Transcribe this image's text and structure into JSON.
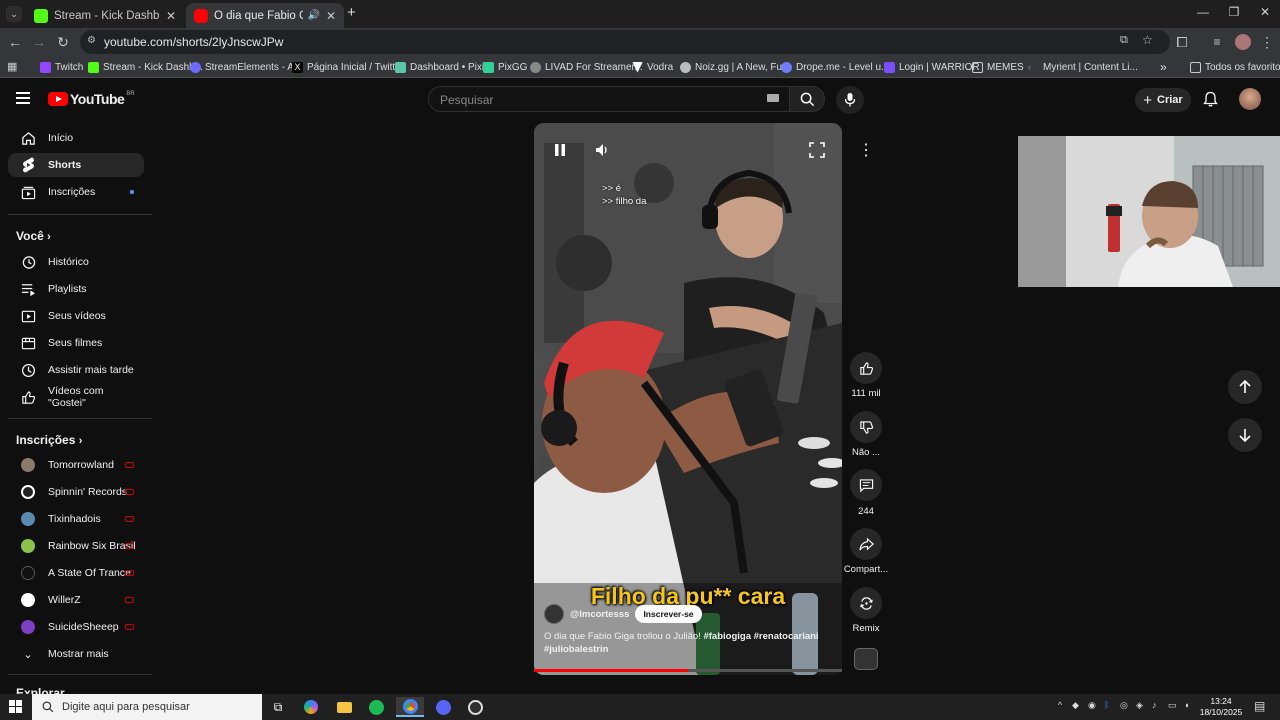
{
  "browser": {
    "tabs": [
      {
        "title": "Stream - Kick Dashboard",
        "favicon_color": "#53fc18"
      },
      {
        "title": "O dia que Fabio Giga trollou",
        "favicon_color": "#ff0000"
      }
    ],
    "new_tab_symbol": "+",
    "url": "youtube.com/shorts/2lyJnscwJPw",
    "bookmarks": [
      {
        "label": "Twitch",
        "color": "#9146ff"
      },
      {
        "label": "Stream - Kick Dashb...",
        "color": "#53fc18"
      },
      {
        "label": "StreamElements - A...",
        "color": "#6b6bff"
      },
      {
        "label": "Página Inicial / Twitter",
        "color": "#e8e8e8"
      },
      {
        "label": "Dashboard • Pixie",
        "color": "#5ac8a8"
      },
      {
        "label": "PixGG",
        "color": "#32d296"
      },
      {
        "label": "LIVAD For Streamer...",
        "color": "#cccccc"
      },
      {
        "label": "Vodra",
        "color": "#ffffff"
      },
      {
        "label": "Noiz.gg | A New, Fu...",
        "color": "#bbbbbb"
      },
      {
        "label": "Drope.me - Level u...",
        "color": "#6e7cff"
      },
      {
        "label": "Login | WARRIOR",
        "color": "#7a4dff"
      },
      {
        "label": "MEMES",
        "color": "#cccccc"
      },
      {
        "label": "Myrient | Content Li...",
        "color": "#999999"
      }
    ],
    "bookmarks_overflow": "»",
    "all_bookmarks": "Todos os favoritos"
  },
  "youtube": {
    "logo_text": "YouTube",
    "country_code": "BR",
    "search_placeholder": "Pesquisar",
    "create_label": "Criar",
    "sidebar": {
      "main": [
        {
          "label": "Início",
          "icon": "home-icon"
        },
        {
          "label": "Shorts",
          "icon": "shorts-icon",
          "active": true
        },
        {
          "label": "Inscrições",
          "icon": "subscriptions-icon"
        }
      ],
      "you_header": "Você",
      "you": [
        {
          "label": "Histórico",
          "icon": "history-icon"
        },
        {
          "label": "Playlists",
          "icon": "playlists-icon"
        },
        {
          "label": "Seus vídeos",
          "icon": "your-videos-icon"
        },
        {
          "label": "Seus filmes",
          "icon": "movies-icon"
        },
        {
          "label": "Assistir mais tarde",
          "icon": "watch-later-icon"
        },
        {
          "label": "Vídeos com \"Gostei\"",
          "icon": "liked-icon"
        }
      ],
      "subs_header": "Inscrições",
      "subscriptions": [
        {
          "label": "Tomorrowland",
          "color": "#8a7a6a"
        },
        {
          "label": "Spinnin' Records",
          "color": "#222222"
        },
        {
          "label": "Tixinhadois",
          "color": "#5a8ab0"
        },
        {
          "label": "Rainbow Six Brasil",
          "color": "#8bc34a"
        },
        {
          "label": "A State Of Trance",
          "color": "#111111"
        },
        {
          "label": "WillerZ",
          "color": "#ffffff"
        },
        {
          "label": "SuicideSheeep",
          "color": "#7b3fbf"
        }
      ],
      "show_more": "Mostrar mais",
      "explore_header": "Explorar"
    },
    "short": {
      "subtitle_lines": [
        ">> é",
        ">> filho da"
      ],
      "caption": "Filho da pu** cara",
      "channel": "@lmcortesss",
      "subscribe_label": "Inscrever-se",
      "title": "O dia que Fabio Giga trollou o Julião! ",
      "hashtags_line1": "#fabiogiga  #renatocariani",
      "hashtags_line2": "#juliobalestrin",
      "progress": 0.5
    },
    "actions": [
      {
        "name": "like",
        "label": "111 mil"
      },
      {
        "name": "dislike",
        "label": "Não ..."
      },
      {
        "name": "comments",
        "label": "244"
      },
      {
        "name": "share",
        "label": "Compart..."
      },
      {
        "name": "remix",
        "label": "Remix"
      }
    ]
  },
  "taskbar": {
    "search_placeholder": "Digite aqui para pesquisar",
    "time": "13:24",
    "date": "18/10/2025"
  }
}
